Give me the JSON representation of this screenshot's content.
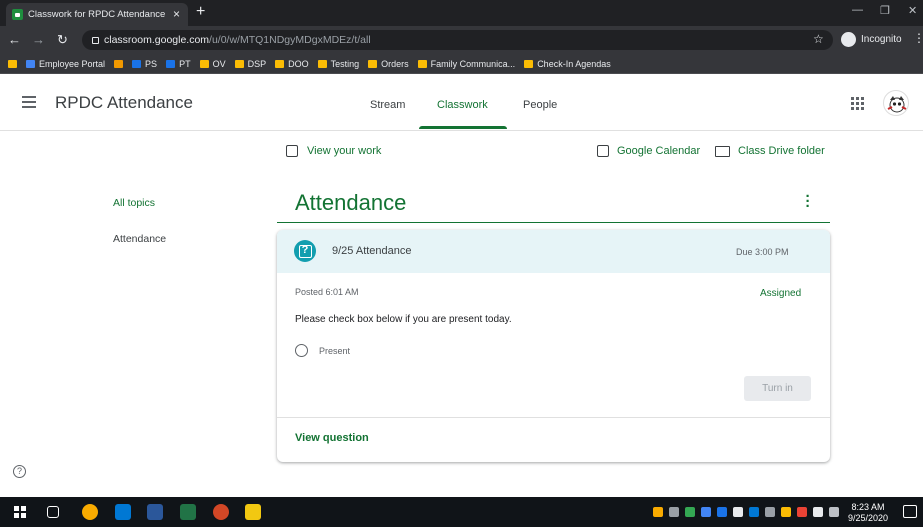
{
  "browser": {
    "tab_title": "Classwork for RPDC Attendance",
    "tab_close": "×",
    "new_tab": "+",
    "url_host": "classroom.google.com",
    "url_path": "/u/0/w/MTQ1NDgyMDgxMDEz/t/all",
    "profile_label": "Incognito",
    "bookmarks": [
      {
        "label": "",
        "color": "#fbbc04"
      },
      {
        "label": "Employee Portal",
        "color": "#4285f4"
      },
      {
        "label": "",
        "color": "#f29900"
      },
      {
        "label": "PS",
        "color": "#1a73e8"
      },
      {
        "label": "PT",
        "color": "#1a73e8"
      },
      {
        "label": "OV",
        "color": "#fbbc04"
      },
      {
        "label": "DSP",
        "color": "#fbbc04"
      },
      {
        "label": "DOO",
        "color": "#fbbc04"
      },
      {
        "label": "Testing",
        "color": "#fbbc04"
      },
      {
        "label": "Orders",
        "color": "#fbbc04"
      },
      {
        "label": "Family Communica...",
        "color": "#fbbc04"
      },
      {
        "label": "Check-In Agendas",
        "color": "#fbbc04"
      }
    ]
  },
  "header": {
    "class_name": "RPDC Attendance",
    "tabs": [
      "Stream",
      "Classwork",
      "People"
    ],
    "active_tab": "Classwork"
  },
  "actions": {
    "view_your_work": "View your work",
    "google_calendar": "Google Calendar",
    "class_drive_folder": "Class Drive folder"
  },
  "sidebar": {
    "all_topics": "All topics",
    "topics": [
      "Attendance"
    ]
  },
  "topic": {
    "title": "Attendance"
  },
  "assignment": {
    "title": "9/25 Attendance",
    "due": "Due 3:00 PM",
    "posted": "Posted 6:01 AM",
    "status": "Assigned",
    "instructions": "Please check box below if you are present today.",
    "option": "Present",
    "turn_in": "Turn in",
    "view_question": "View question"
  },
  "help_symbol": "?",
  "taskbar": {
    "time": "8:23 AM",
    "date": "9/25/2020"
  },
  "colors": {
    "accent_green": "#137333",
    "card_header_bg": "#e6f4f7",
    "question_icon": "#129eaf"
  }
}
